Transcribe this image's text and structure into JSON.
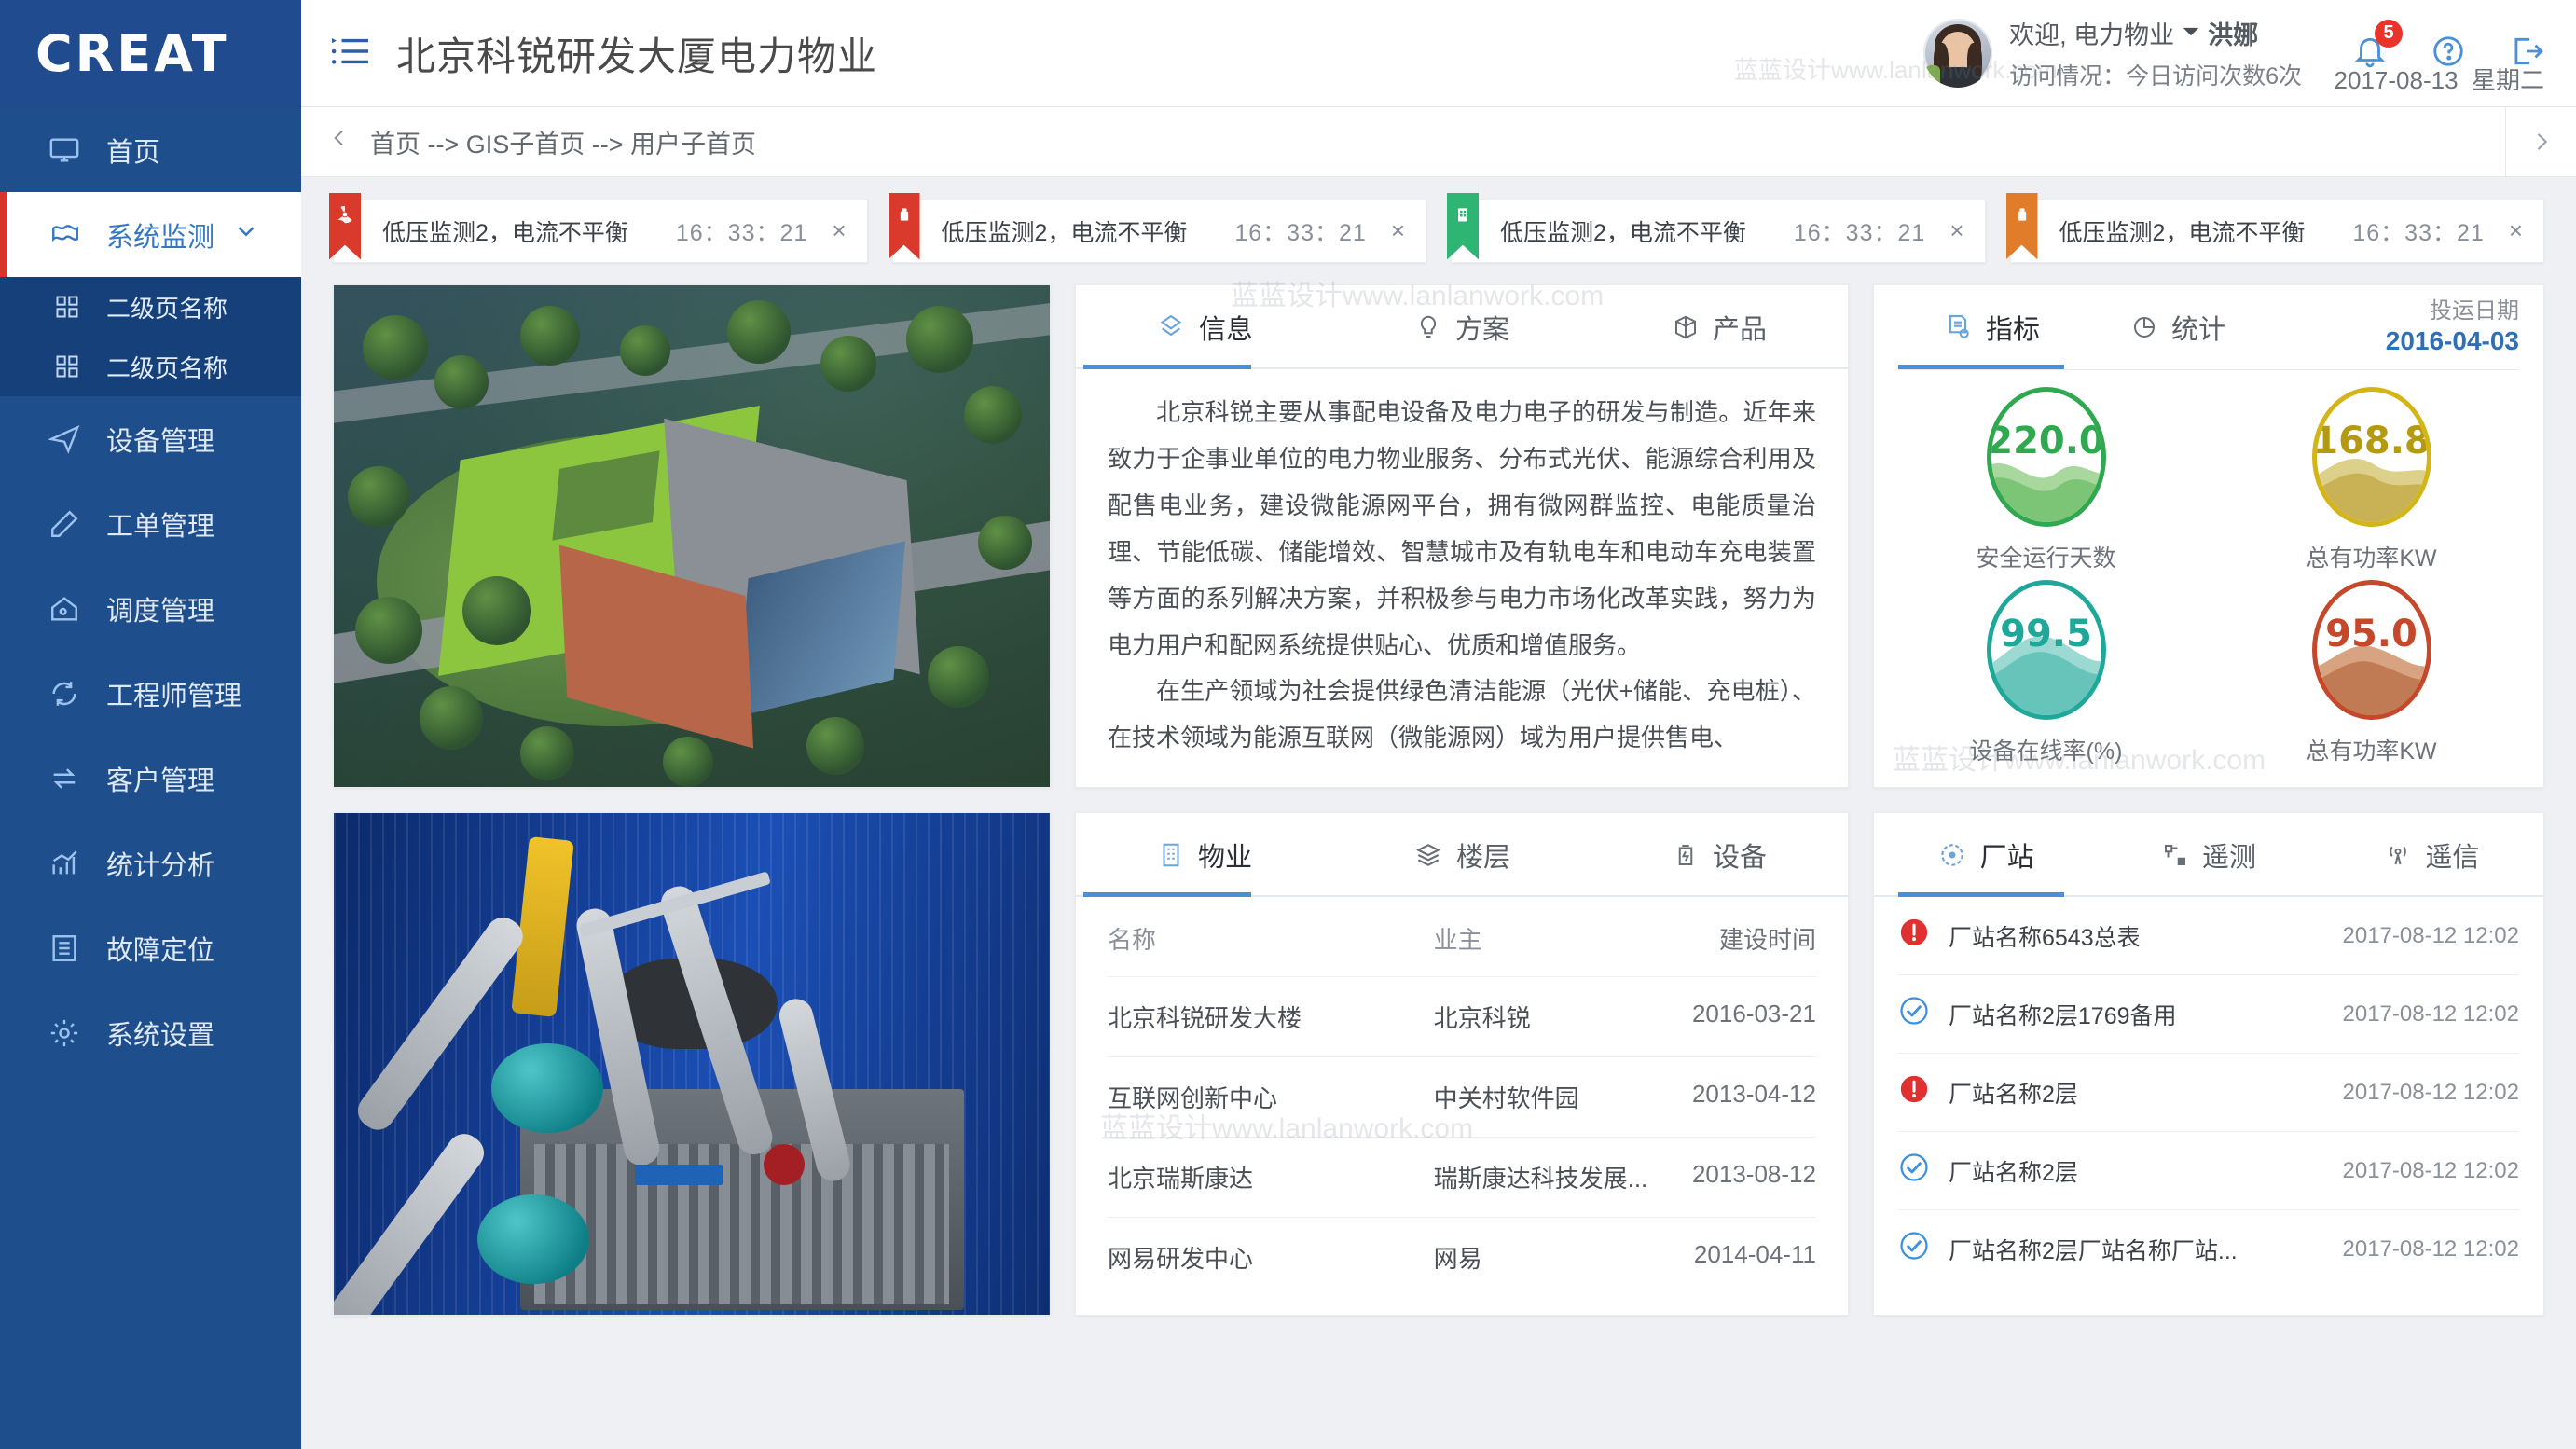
{
  "brand": {
    "name": "CREAT"
  },
  "header": {
    "menu_icon": "hamburger-list-icon",
    "title": "北京科锐研发大厦电力物业",
    "welcome_prefix": "欢迎, 电力物业",
    "user_name": "洪娜",
    "visits_text": "访问情况：今日访问次数6次",
    "notification_count": "5",
    "date": "2017-08-13",
    "weekday": "星期二",
    "icons": [
      "bell-icon",
      "help-icon",
      "logout-icon"
    ]
  },
  "breadcrumb": {
    "back_icon": "chevron-left-icon",
    "path": "首页 --> GIS子首页 --> 用户子首页",
    "forward_icon": "chevron-right-icon"
  },
  "sidebar": {
    "items": [
      {
        "label": "首页",
        "icon": "monitor-icon",
        "active": false
      },
      {
        "label": "系统监测",
        "icon": "monitor-chart-icon",
        "active": true,
        "chevron": "chevron-down-icon"
      },
      {
        "label": "设备管理",
        "icon": "paper-plane-icon",
        "active": false
      },
      {
        "label": "工单管理",
        "icon": "pencil-icon",
        "active": false
      },
      {
        "label": "调度管理",
        "icon": "home-gear-icon",
        "active": false
      },
      {
        "label": "工程师管理",
        "icon": "refresh-gear-icon",
        "active": false
      },
      {
        "label": "客户管理",
        "icon": "swap-arrows-icon",
        "active": false
      },
      {
        "label": "统计分析",
        "icon": "bar-chart-icon",
        "active": false
      },
      {
        "label": "故障定位",
        "icon": "list-document-icon",
        "active": false
      },
      {
        "label": "系统设置",
        "icon": "gear-icon",
        "active": false
      }
    ],
    "subitems": [
      {
        "label": "二级页名称",
        "icon": "grid-icon"
      },
      {
        "label": "二级页名称",
        "icon": "grid-icon"
      }
    ]
  },
  "alerts": [
    {
      "text": "低压监测2，电流不平衡",
      "time": "16：33：21",
      "flag_color": "#d93a2b",
      "flag_icon": "radiation-icon",
      "close": "×"
    },
    {
      "text": "低压监测2，电流不平衡",
      "time": "16：33：21",
      "flag_color": "#d93a2b",
      "flag_icon": "transformer-icon",
      "close": "×"
    },
    {
      "text": "低压监测2，电流不平衡",
      "time": "16：33：21",
      "flag_color": "#2fb573",
      "flag_icon": "building-icon",
      "close": "×"
    },
    {
      "text": "低压监测2，电流不平衡",
      "time": "16：33：21",
      "flag_color": "#e07c2a",
      "flag_icon": "transformer-icon",
      "close": "×"
    }
  ],
  "info_panel": {
    "tabs": [
      {
        "label": "信息",
        "icon": "layers-diamond-icon",
        "active": true
      },
      {
        "label": "方案",
        "icon": "lightbulb-icon",
        "active": false
      },
      {
        "label": "产品",
        "icon": "box-package-icon",
        "active": false
      }
    ],
    "paragraphs": [
      "北京科锐主要从事配电设备及电力电子的研发与制造。近年来致力于企事业单位的电力物业服务、分布式光伏、能源综合利用及配售电业务，建设微能源网平台，拥有微网群监控、电能质量治理、节能低碳、储能增效、智慧城市及有轨电车和电动车充电装置等方面的系列解决方案，并积极参与电力市场化改革实践，努力为电力用户和配网系统提供贴心、优质和增值服务。",
      "在生产领域为社会提供绿色清洁能源（光伏+储能、充电桩）、在技术领域为能源互联网（微能源网）域为用户提供售电、"
    ]
  },
  "metric_panel": {
    "tabs": [
      {
        "label": "指标",
        "icon": "document-gear-icon",
        "active": true
      },
      {
        "label": "统计",
        "icon": "pie-chart-icon",
        "active": false
      }
    ],
    "date_label": "投运日期",
    "date_value": "2016-04-03",
    "gauges": [
      {
        "value": "220.0",
        "label": "安全运行天数",
        "color": "#2fa84f",
        "fill": "#7cc576",
        "fill2": "#a9d89f"
      },
      {
        "value": "168.8",
        "label": "总有功率KW",
        "color": "#d4b517",
        "fill": "#c9b255",
        "fill2": "#ddd08a"
      },
      {
        "value": "99.5",
        "label": "设备在线率(%)",
        "color": "#1fa89a",
        "fill": "#67c4bb",
        "fill2": "#9cd9d2"
      },
      {
        "value": "95.0",
        "label": "总有功率KW",
        "color": "#c6482a",
        "fill": "#c07b55",
        "fill2": "#d8a381"
      }
    ]
  },
  "property_panel": {
    "tabs": [
      {
        "label": "物业",
        "icon": "building-icon",
        "active": true
      },
      {
        "label": "楼层",
        "icon": "layers-icon",
        "active": false
      },
      {
        "label": "设备",
        "icon": "device-bolt-icon",
        "active": false
      }
    ],
    "columns": [
      "名称",
      "业主",
      "建设时间"
    ],
    "rows": [
      {
        "name": "北京科锐研发大楼",
        "owner": "北京科锐",
        "date": "2016-03-21"
      },
      {
        "name": "互联网创新中心",
        "owner": "中关村软件园",
        "date": "2013-04-12"
      },
      {
        "name": "北京瑞斯康达",
        "owner": "瑞斯康达科技发展...",
        "date": "2013-08-12"
      },
      {
        "name": "网易研发中心",
        "owner": "网易",
        "date": "2014-04-11"
      }
    ]
  },
  "station_panel": {
    "tabs": [
      {
        "label": "厂站",
        "icon": "station-circle-icon",
        "active": true
      },
      {
        "label": "遥测",
        "icon": "telemetry-icon",
        "active": false
      },
      {
        "label": "遥信",
        "icon": "signal-tower-icon",
        "active": false
      }
    ],
    "rows": [
      {
        "status": "alert",
        "status_icon": "exclamation-circle-icon",
        "name": "厂站名称6543总表",
        "time": "2017-08-12 12:02"
      },
      {
        "status": "ok",
        "status_icon": "check-circle-icon",
        "name": "厂站名称2层1769备用",
        "time": "2017-08-12 12:02"
      },
      {
        "status": "alert",
        "status_icon": "exclamation-circle-icon",
        "name": "厂站名称2层",
        "time": "2017-08-12 12:02"
      },
      {
        "status": "ok",
        "status_icon": "check-circle-icon",
        "name": "厂站名称2层",
        "time": "2017-08-12 12:02"
      },
      {
        "status": "ok",
        "status_icon": "check-circle-icon",
        "name": "厂站名称2层厂站名称厂站...",
        "time": "2017-08-12 12:02"
      }
    ]
  },
  "images": {
    "aerial": "aerial-building-photo",
    "transformer": "power-transformer-photo"
  },
  "watermarks": [
    "蓝蓝设计www.lanlanwork.com",
    "蓝蓝设计www.lanlanwork.com",
    "蓝蓝设计www.lanlanwork.com",
    "蓝蓝设计www.lanlanwork.com"
  ],
  "colors": {
    "sidebar_bg": "#1f4e8c",
    "sidebar_sub_bg": "#15407a",
    "accent": "#4a90d9",
    "active_marker": "#d9342b",
    "badge": "#e8342b"
  }
}
